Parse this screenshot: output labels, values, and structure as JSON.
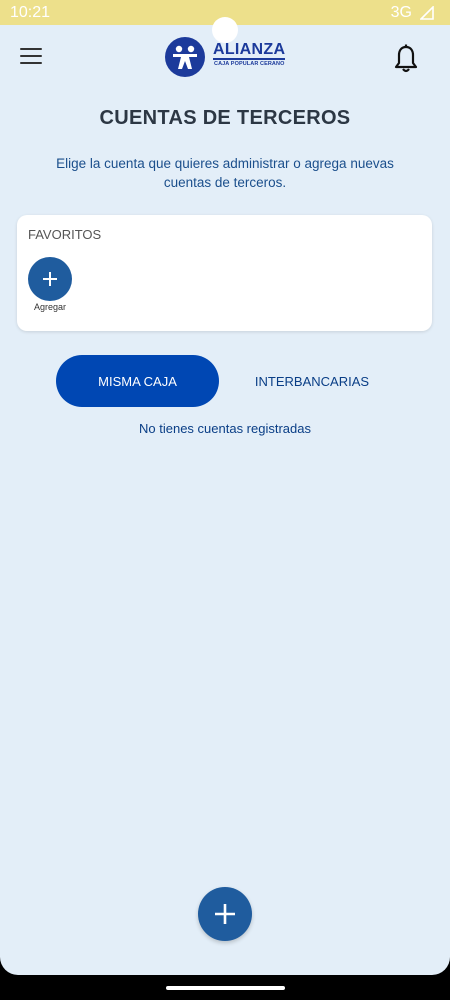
{
  "status_bar": {
    "time": "10:21",
    "network": "3G",
    "icons": [
      "signal-icon"
    ],
    "color": "#ede08b"
  },
  "header": {
    "logo_name": "ALIANZA",
    "logo_sub": "CAJA POPULAR CERANO",
    "icons": [
      "menu-icon",
      "logo-icon",
      "bell-icon"
    ]
  },
  "page": {
    "title": "CUENTAS DE TERCEROS",
    "subtitle": "Elige la cuenta que quieres administrar o agrega nuevas cuentas de terceros."
  },
  "favorites": {
    "label": "FAVORITOS",
    "add_label": "Agregar",
    "icon": "plus-icon"
  },
  "tabs": [
    {
      "label": "MISMA CAJA",
      "active": true
    },
    {
      "label": "INTERBANCARIAS",
      "active": false
    }
  ],
  "empty_message": "No tienes cuentas registradas",
  "fab": {
    "icon": "plus-icon"
  },
  "colors": {
    "background": "#e3eef8",
    "primary": "#0047b3",
    "accent": "#1f5c9e",
    "brand": "#1c3a9b"
  }
}
